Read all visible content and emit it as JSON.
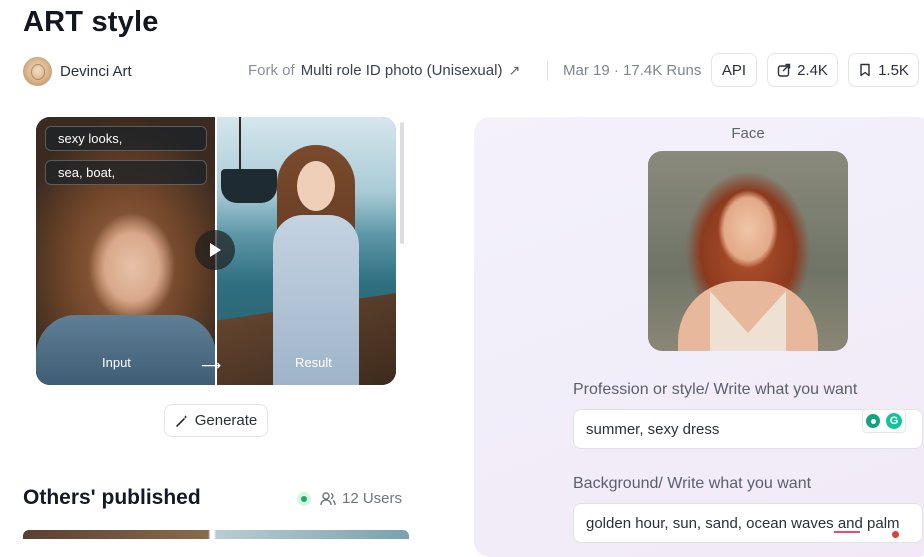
{
  "header": {
    "title": "ART style",
    "author": "Devinci Art",
    "fork_prefix": "Fork of",
    "fork_source": "Multi role ID photo  (Unisexual)",
    "fork_arrow": "↗",
    "meta": "Mar 19 · 17.4K Runs",
    "api_label": "API",
    "share_count": "2.4K",
    "save_count": "1.5K"
  },
  "preview": {
    "tags": [
      "sexy looks,",
      "sea, boat,"
    ],
    "input_label": "Input",
    "result_label": "Result",
    "arrow": "⟶"
  },
  "generate_label": "Generate",
  "others": {
    "title": "Others' published",
    "users": "12 Users"
  },
  "form": {
    "face_label": "Face",
    "profession_label": "Profession or style/ Write what you want",
    "profession_value": "summer, sexy dress",
    "background_label": "Background/ Write what you want",
    "background_value": "golden hour, sun, sand, ocean waves and palm"
  },
  "icons": {
    "play": "play-icon",
    "share": "share-icon",
    "bookmark": "bookmark-icon",
    "magic": "magic-wand-icon",
    "users": "users-icon"
  },
  "colors": {
    "online": "#18b15b",
    "panel_bg": "#f1eefa"
  }
}
